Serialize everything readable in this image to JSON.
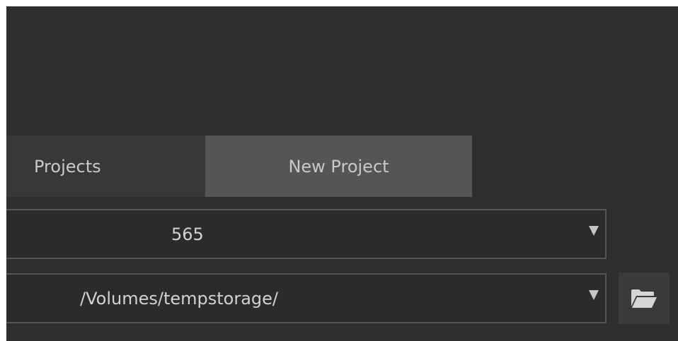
{
  "tabs": {
    "projects_label": "Projects",
    "new_project_label": "New Project",
    "active": "New Project"
  },
  "fields": {
    "number_select_value": "565",
    "path_select_value": "/Volumes/tempstorage/"
  },
  "icons": {
    "dropdown": "triangle-down-icon",
    "folder": "folder-open-icon"
  },
  "colors": {
    "background": "#2e2e2e",
    "active_tab": "#555555",
    "inactive_tab": "#383838",
    "text": "#c9c9c9"
  }
}
